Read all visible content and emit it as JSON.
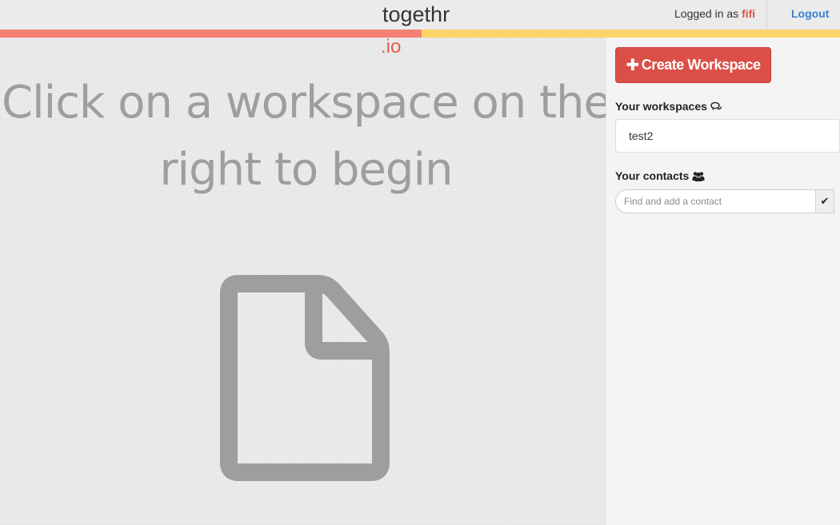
{
  "header": {
    "brand_main": "togethr",
    "brand_sub": ".io",
    "logged_in_prefix": "Logged in as",
    "username": "fifi",
    "logout_label": "Logout"
  },
  "progress": {
    "left_fraction": 0.502,
    "left_color": "#f47f72",
    "right_color": "#fdd469"
  },
  "main": {
    "headline": "Click on a workspace on the right to begin",
    "icon": "file-icon"
  },
  "sidebar": {
    "create_button_label": "Create Workspace",
    "create_button_icon": "plus-icon",
    "workspaces_label": "Your workspaces",
    "workspaces_icon": "chat-bubbles-icon",
    "workspaces": [
      {
        "name": "test2"
      }
    ],
    "contacts_label": "Your contacts",
    "contacts_icon": "users-icon",
    "contact_search_placeholder": "Find and add a contact",
    "contact_search_value": "",
    "contact_submit_icon": "check-icon"
  },
  "colors": {
    "accent_red": "#db4f48",
    "link_blue": "#3a7fd5",
    "username_red": "#d9534f"
  }
}
